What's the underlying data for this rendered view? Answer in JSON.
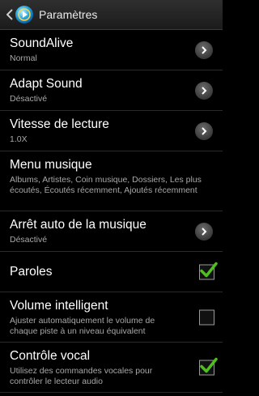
{
  "header": {
    "title": "Paramètres",
    "back_icon": "chevron-left-icon",
    "app_icon": "music-player-icon"
  },
  "settings": [
    {
      "title": "SoundAlive",
      "subtitle": "Normal",
      "control": "chevron"
    },
    {
      "title": "Adapt Sound",
      "subtitle": "Désactivé",
      "control": "chevron"
    },
    {
      "title": "Vitesse de lecture",
      "subtitle": "1.0X",
      "control": "chevron"
    },
    {
      "title": "Menu musique",
      "subtitle": "Albums, Artistes, Coin musique, Dossiers, Les plus écoutés, Écoutés récemment, Ajoutés récemment",
      "control": "none"
    },
    {
      "title": "Arrêt auto de la musique",
      "subtitle": "Désactivé",
      "control": "chevron"
    },
    {
      "title": "Paroles",
      "subtitle": "",
      "control": "checkbox",
      "checked": true
    },
    {
      "title": "Volume intelligent",
      "subtitle": "Ajuster automatiquement le volume de chaque piste à un niveau équivalent",
      "control": "checkbox",
      "checked": false
    },
    {
      "title": "Contrôle vocal",
      "subtitle": "Utilisez des commandes vocales pour contrôler le lecteur audio",
      "control": "checkbox",
      "checked": true
    }
  ],
  "colors": {
    "accent_check": "#4fbf1f",
    "background": "#000000",
    "subtitle": "#a8a8a8"
  }
}
